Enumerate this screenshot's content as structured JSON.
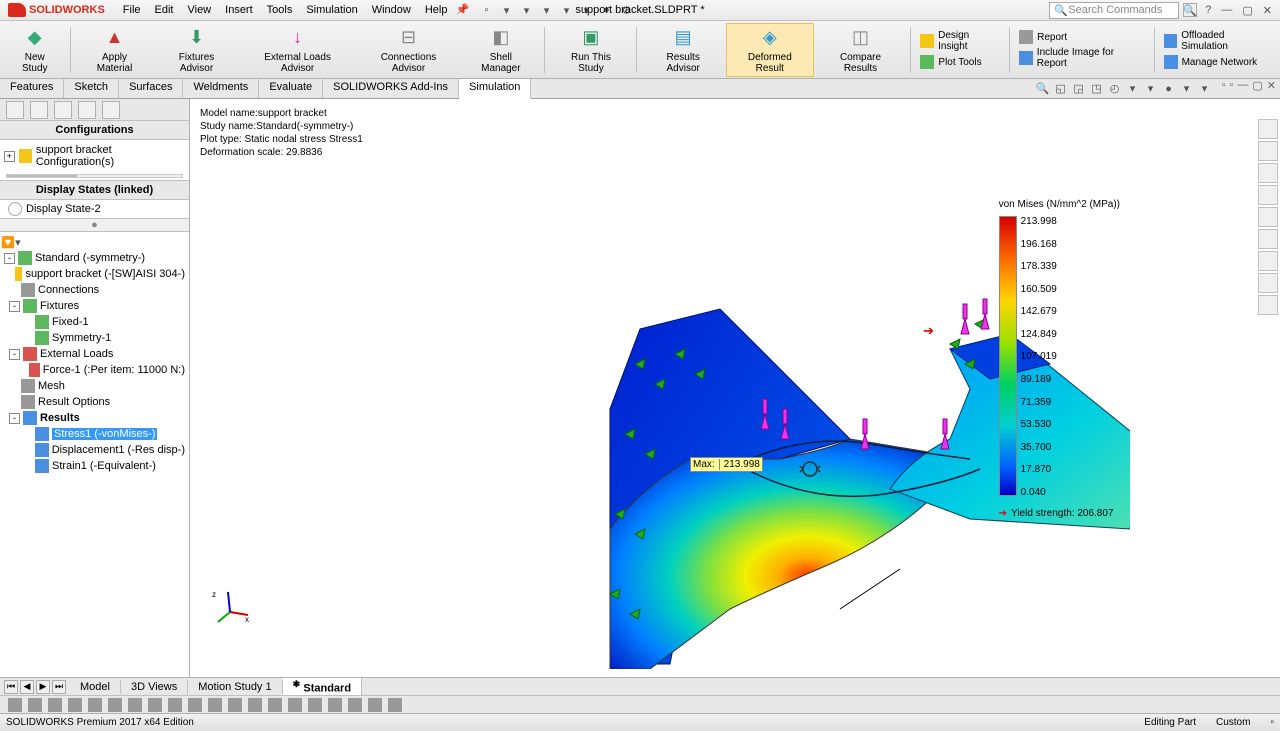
{
  "app": {
    "name": "SOLIDWORKS",
    "documentTitle": "support bracket.SLDPRT *",
    "searchPlaceholder": "Search Commands"
  },
  "menu": [
    "File",
    "Edit",
    "View",
    "Insert",
    "Tools",
    "Simulation",
    "Window",
    "Help"
  ],
  "commandManager": {
    "newStudy": "New Study",
    "applyMaterial": "Apply Material",
    "fixturesAdvisor": "Fixtures Advisor",
    "externalLoadsAdvisor": "External Loads Advisor",
    "connectionsAdvisor": "Connections Advisor",
    "shellManager": "Shell Manager",
    "runThisStudy": "Run This Study",
    "resultsAdvisor": "Results Advisor",
    "deformedResult": "Deformed Result",
    "compareResults": "Compare Results",
    "designInsight": "Design Insight",
    "plotTools": "Plot Tools",
    "report": "Report",
    "includeImage": "Include Image for Report",
    "offloaded": "Offloaded Simulation",
    "manageNetwork": "Manage Network"
  },
  "tabs": [
    "Features",
    "Sketch",
    "Surfaces",
    "Weldments",
    "Evaluate",
    "SOLIDWORKS Add-Ins",
    "Simulation"
  ],
  "activeTab": "Simulation",
  "fm": {
    "configHeader": "Configurations",
    "configRoot": "support bracket Configuration(s)",
    "displayStatesHeader": "Display States (linked)",
    "displayState": "Display State-2"
  },
  "simTree": {
    "study": "Standard (-symmetry-)",
    "part": "support bracket (-[SW]AISI 304-)",
    "connections": "Connections",
    "fixtures": "Fixtures",
    "fixed": "Fixed-1",
    "symmetry": "Symmetry-1",
    "externalLoads": "External Loads",
    "force": "Force-1 (:Per item: 11000 N:)",
    "mesh": "Mesh",
    "resultOptions": "Result Options",
    "results": "Results",
    "stress": "Stress1 (-vonMises-)",
    "displacement": "Displacement1 (-Res disp-)",
    "strain": "Strain1 (-Equivalent-)"
  },
  "plotInfo": {
    "line1": "Model name:support bracket",
    "line2": "Study name:Standard(-symmetry-)",
    "line3": "Plot type: Static nodal stress Stress1",
    "line4": "Deformation scale: 29.8836"
  },
  "legend": {
    "title": "von Mises (N/mm^2 (MPa))",
    "values": [
      "213.998",
      "196.168",
      "178.339",
      "160.509",
      "142.679",
      "124.849",
      "107.019",
      "89.189",
      "71.359",
      "53.530",
      "35.700",
      "17.870",
      "0.040"
    ],
    "yieldLabel": "Yield strength: 206.807"
  },
  "callout": {
    "label": "Max:",
    "value": "213.998"
  },
  "bottomTabs": [
    "Model",
    "3D Views",
    "Motion Study 1",
    "Standard"
  ],
  "activeBottomTab": "Standard",
  "status": {
    "edition": "SOLIDWORKS Premium 2017 x64 Edition",
    "mode": "Editing Part",
    "units": "Custom"
  }
}
